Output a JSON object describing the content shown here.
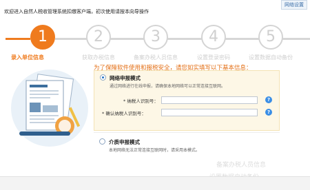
{
  "header": {
    "welcome": "欢迎进入自然人税收管理系统扣缴客户端，初次使用请按本向导操作",
    "net_setting": "网络设置"
  },
  "stepper": {
    "steps": [
      {
        "number": "1",
        "label": "录入单位信息",
        "active": true
      },
      {
        "number": "2",
        "label": "获取办税信息",
        "active": false
      },
      {
        "number": "3",
        "label": "备案办税人员信息",
        "active": false
      },
      {
        "number": "4",
        "label": "设置登录密码",
        "active": false
      },
      {
        "number": "5",
        "label": "设置数据自动备份",
        "active": false
      }
    ]
  },
  "form": {
    "prompt": "为了保障软件使用和报税安全，请您如实填写以下基本信息：",
    "online": {
      "title": "网络申报模式",
      "desc": "通过网络进行在线申报，请确保本地网络可以正常连接互联网。",
      "checked": true
    },
    "taxpayer_id": {
      "label": "* 纳税人识别号：",
      "value": ""
    },
    "confirm_taxpayer_id": {
      "label": "* 确认纳税人识别号：",
      "value": ""
    },
    "media": {
      "title": "介质申报模式",
      "desc": "本地网络无法正常连接互联网时，请采用本模式。",
      "checked": false
    },
    "help_glyph": "?"
  },
  "watermark": {
    "line1": "备案办税人员信息",
    "line2": "设置数据自动备份"
  },
  "colors": {
    "accent": "#ef7b1e",
    "inactive": "#d4d4d4",
    "panel_bg": "#fdf7e6",
    "help_blue": "#3a8ee6"
  }
}
